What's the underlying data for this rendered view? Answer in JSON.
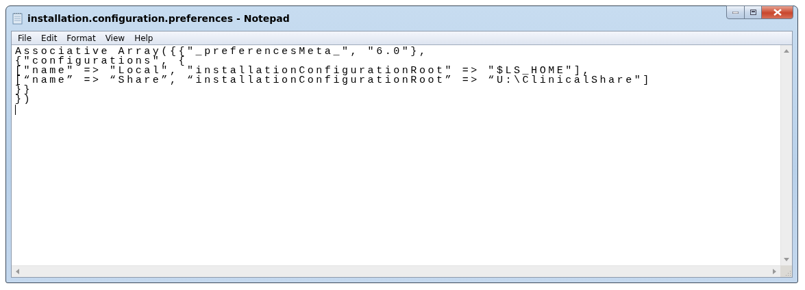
{
  "window": {
    "title": "installation.configuration.preferences - Notepad"
  },
  "menu": [
    "File",
    "Edit",
    "Format",
    "View",
    "Help"
  ],
  "editor": {
    "lines": [
      "Associative Array({{\"_preferencesMeta_\", \"6.0\"},",
      "{\"configurations\", {",
      "[\"name\" => \"Local\", \"installationConfigurationRoot\" => \"$LS_HOME\"],",
      "[“name” => “Share”, “installationConfigurationRoot” => “U:\\ClinicalShare\"]",
      "}}",
      "})"
    ]
  }
}
